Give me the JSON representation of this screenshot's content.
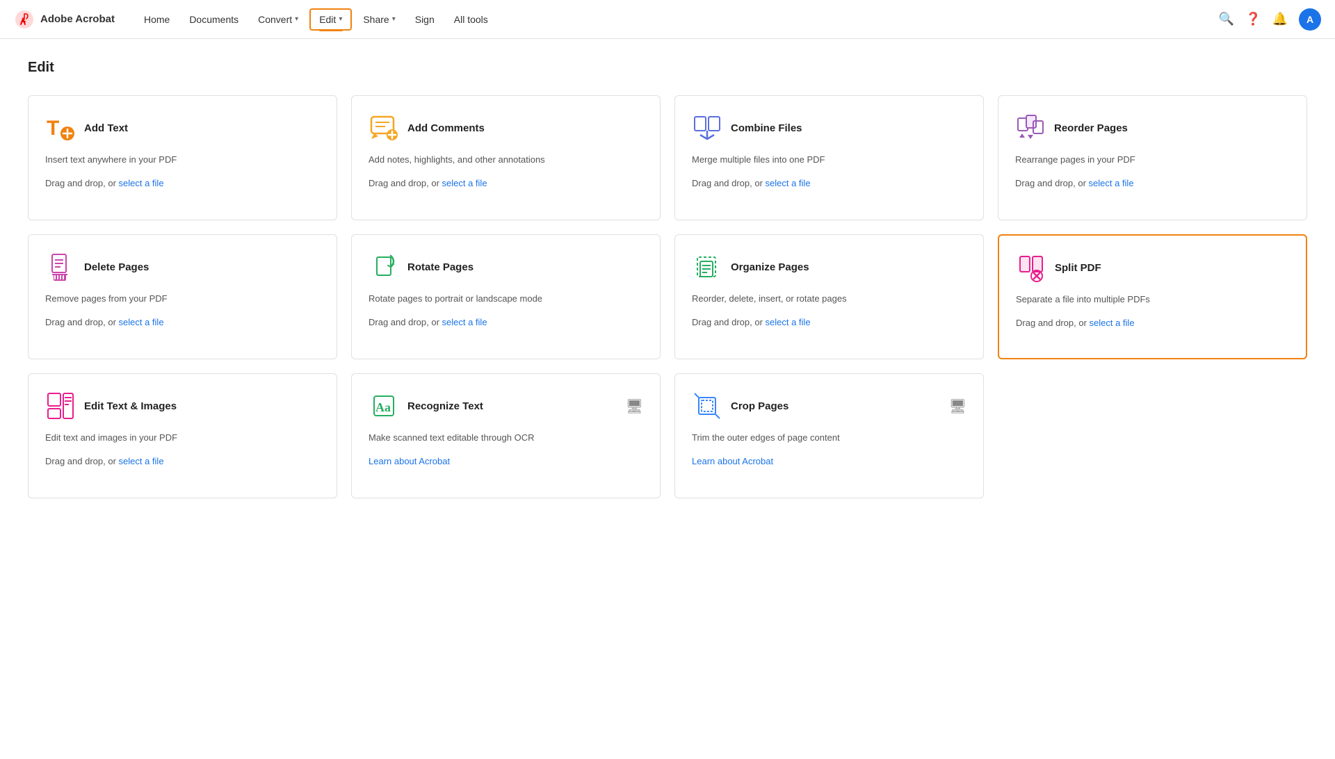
{
  "brand": {
    "name": "Adobe Acrobat"
  },
  "nav": {
    "items": [
      {
        "label": "Home",
        "hasDropdown": false,
        "active": false
      },
      {
        "label": "Documents",
        "hasDropdown": false,
        "active": false
      },
      {
        "label": "Convert",
        "hasDropdown": true,
        "active": false
      },
      {
        "label": "Edit",
        "hasDropdown": true,
        "active": true
      },
      {
        "label": "Share",
        "hasDropdown": true,
        "active": false
      },
      {
        "label": "Sign",
        "hasDropdown": false,
        "active": false
      },
      {
        "label": "All tools",
        "hasDropdown": false,
        "active": false
      }
    ],
    "avatar_letter": "A"
  },
  "page": {
    "title": "Edit"
  },
  "tools": [
    {
      "id": "add-text",
      "title": "Add Text",
      "description": "Insert text anywhere in your PDF",
      "action_prefix": "Drag and drop, or ",
      "action_link": "select a file",
      "highlighted": false,
      "has_desktop": false,
      "learn_link": null
    },
    {
      "id": "add-comments",
      "title": "Add Comments",
      "description": "Add notes, highlights, and other annotations",
      "action_prefix": "Drag and drop, or ",
      "action_link": "select a file",
      "highlighted": false,
      "has_desktop": false,
      "learn_link": null
    },
    {
      "id": "combine-files",
      "title": "Combine Files",
      "description": "Merge multiple files into one PDF",
      "action_prefix": "Drag and drop, or ",
      "action_link": "select a file",
      "highlighted": false,
      "has_desktop": false,
      "learn_link": null
    },
    {
      "id": "reorder-pages",
      "title": "Reorder Pages",
      "description": "Rearrange pages in your PDF",
      "action_prefix": "Drag and drop, or ",
      "action_link": "select a file",
      "highlighted": false,
      "has_desktop": false,
      "learn_link": null
    },
    {
      "id": "delete-pages",
      "title": "Delete Pages",
      "description": "Remove pages from your PDF",
      "action_prefix": "Drag and drop, or ",
      "action_link": "select a file",
      "highlighted": false,
      "has_desktop": false,
      "learn_link": null
    },
    {
      "id": "rotate-pages",
      "title": "Rotate Pages",
      "description": "Rotate pages to portrait or landscape mode",
      "action_prefix": "Drag and drop, or ",
      "action_link": "select a file",
      "highlighted": false,
      "has_desktop": false,
      "learn_link": null
    },
    {
      "id": "organize-pages",
      "title": "Organize Pages",
      "description": "Reorder, delete, insert, or rotate pages",
      "action_prefix": "Drag and drop, or ",
      "action_link": "select a file",
      "highlighted": false,
      "has_desktop": false,
      "learn_link": null
    },
    {
      "id": "split-pdf",
      "title": "Split PDF",
      "description": "Separate a file into multiple PDFs",
      "action_prefix": "Drag and drop, or ",
      "action_link": "select a file",
      "highlighted": true,
      "has_desktop": false,
      "learn_link": null
    },
    {
      "id": "edit-text-images",
      "title": "Edit Text & Images",
      "description": "Edit text and images in your PDF",
      "action_prefix": "Drag and drop, or ",
      "action_link": "select a file",
      "highlighted": false,
      "has_desktop": false,
      "learn_link": null
    },
    {
      "id": "recognize-text",
      "title": "Recognize Text",
      "description": "Make scanned text editable through OCR",
      "action_prefix": null,
      "action_link": null,
      "highlighted": false,
      "has_desktop": true,
      "learn_link": "Learn about Acrobat"
    },
    {
      "id": "crop-pages",
      "title": "Crop Pages",
      "description": "Trim the outer edges of page content",
      "action_prefix": null,
      "action_link": null,
      "highlighted": false,
      "has_desktop": true,
      "learn_link": "Learn about Acrobat"
    }
  ]
}
